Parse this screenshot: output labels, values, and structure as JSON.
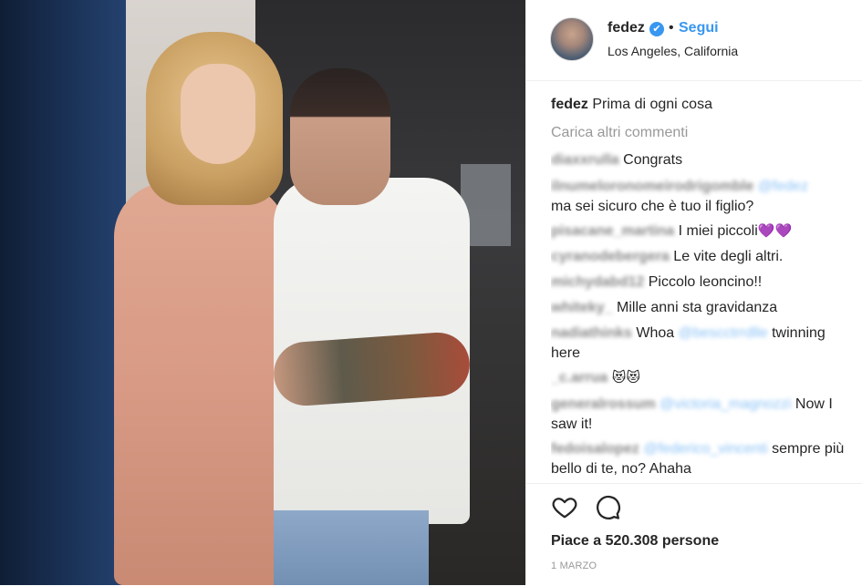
{
  "post": {
    "username": "fedez",
    "follow_label": "Segui",
    "separator": "•",
    "location": "Los Angeles, California",
    "verified_icon": "✔",
    "caption_user": "fedez",
    "caption_text": "Prima di ogni cosa",
    "load_more": "Carica altri commenti",
    "likes": "Piace a 520.308 persone",
    "date": "1 MARZO"
  },
  "comments": [
    {
      "user": "diaxxrulla",
      "text": "Congrats"
    },
    {
      "user": "ilnumeloronomeirodrigomble",
      "mention": "@fedez",
      "text": "ma sei sicuro che è tuo il figlio?"
    },
    {
      "user": "pisacane_martina",
      "text": "I miei piccoli",
      "emoji": "💜💜"
    },
    {
      "user": "cyranodebergera",
      "text": "Le vite degli altri."
    },
    {
      "user": "michydabd12",
      "text": "Piccolo leoncino!!"
    },
    {
      "user": "whiteky_",
      "text": "Mille anni sta gravidanza"
    },
    {
      "user": "nadiathinks",
      "text_before": "Whoa",
      "mention": "@bescctrrdlle",
      "text": "twinning here"
    },
    {
      "user": "_c.arrua",
      "emoji": "😻😻"
    },
    {
      "user": "generalrossum",
      "mention": "@victoria_magnozzi",
      "text": "Now I saw it!"
    },
    {
      "user": "fedoisalopez",
      "mention": "@federico_vincenti",
      "text": "sempre più bello di te, no? Ahaha"
    }
  ],
  "icons": {
    "like": "heart-outline-icon",
    "comment": "speech-bubble-icon"
  }
}
